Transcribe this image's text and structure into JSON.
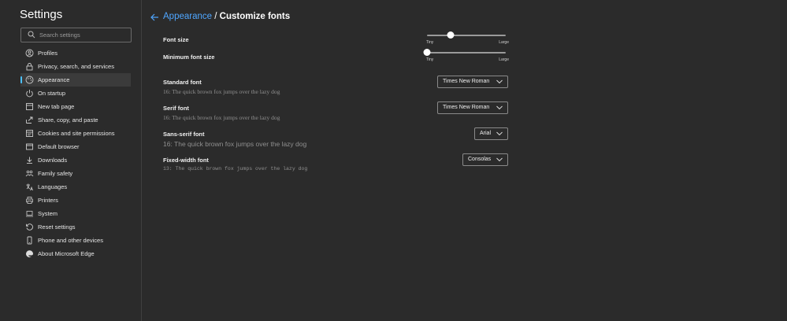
{
  "sidebar": {
    "title": "Settings",
    "search_placeholder": "Search settings",
    "items": [
      {
        "label": "Profiles",
        "icon": "profile-icon"
      },
      {
        "label": "Privacy, search, and services",
        "icon": "lock-icon"
      },
      {
        "label": "Appearance",
        "icon": "appearance-icon",
        "active": true
      },
      {
        "label": "On startup",
        "icon": "power-icon"
      },
      {
        "label": "New tab page",
        "icon": "new-tab-icon"
      },
      {
        "label": "Share, copy, and paste",
        "icon": "share-icon"
      },
      {
        "label": "Cookies and site permissions",
        "icon": "site-permissions-icon"
      },
      {
        "label": "Default browser",
        "icon": "browser-icon"
      },
      {
        "label": "Downloads",
        "icon": "download-icon"
      },
      {
        "label": "Family safety",
        "icon": "family-icon"
      },
      {
        "label": "Languages",
        "icon": "languages-icon"
      },
      {
        "label": "Printers",
        "icon": "printer-icon"
      },
      {
        "label": "System",
        "icon": "system-icon"
      },
      {
        "label": "Reset settings",
        "icon": "reset-icon"
      },
      {
        "label": "Phone and other devices",
        "icon": "phone-icon"
      },
      {
        "label": "About Microsoft Edge",
        "icon": "edge-icon"
      }
    ]
  },
  "header": {
    "parent": "Appearance",
    "separator": "/",
    "current": "Customize fonts"
  },
  "font_size": {
    "label": "Font size",
    "min_label": "Tiny",
    "max_label": "Large",
    "level": 0.3
  },
  "min_font_size": {
    "label": "Minimum font size",
    "min_label": "Tiny",
    "max_label": "Large",
    "level": 0.0
  },
  "standard_font": {
    "label": "Standard font",
    "value": "Times New Roman",
    "preview": "16: The quick brown fox jumps over the lazy dog"
  },
  "serif_font": {
    "label": "Serif font",
    "value": "Times New Roman",
    "preview": "16: The quick brown fox jumps over the lazy dog"
  },
  "sans_serif_font": {
    "label": "Sans-serif font",
    "value": "Arial",
    "preview": "16: The quick brown fox jumps over the lazy dog"
  },
  "fixed_width_font": {
    "label": "Fixed-width font",
    "value": "Consolas",
    "preview": "13: The quick brown fox jumps over the lazy dog"
  },
  "colors": {
    "accent": "#4cc2ff",
    "link": "#4fa6ff",
    "background": "#2b2b2b"
  }
}
